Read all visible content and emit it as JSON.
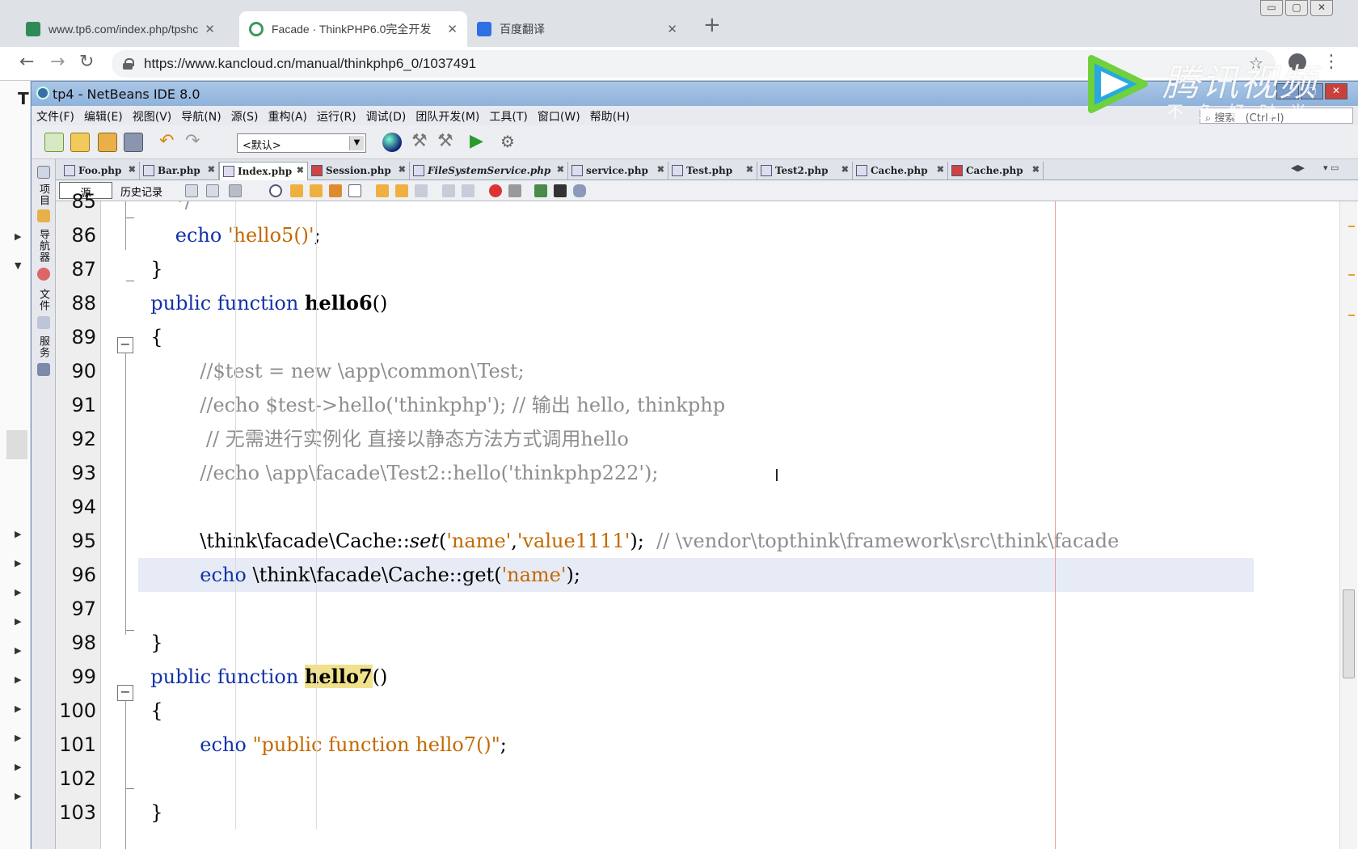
{
  "browser": {
    "tabs": [
      {
        "title": "www.tp6.com/index.php/tpshc",
        "close": "✕",
        "active": false,
        "favicon_color": "#2e8b57"
      },
      {
        "title": "Facade · ThinkPHP6.0完全开发",
        "close": "✕",
        "active": true,
        "favicon_color": "#3a9a5c"
      },
      {
        "title": "百度翻译",
        "close": "✕",
        "active": false,
        "favicon_color": "#2f6fe4"
      }
    ],
    "new_tab": "+",
    "url": "https://www.kancloud.cn/manual/thinkphp6_0/1037491",
    "window_controls": [
      "▭",
      "▢",
      "✕"
    ],
    "page_left_letter": "T"
  },
  "watermark": {
    "brand": "腾讯视频",
    "slogan": "不负好时光"
  },
  "netbeans": {
    "title": "tp4 - NetBeans IDE 8.0",
    "window_controls": [
      "_",
      "▢",
      "✕"
    ],
    "menu": [
      "文件(F)",
      "编辑(E)",
      "视图(V)",
      "导航(N)",
      "源(S)",
      "重构(A)",
      "运行(R)",
      "调试(D)",
      "团队开发(M)",
      "工具(T)",
      "窗口(W)",
      "帮助(H)"
    ],
    "search_label": "搜索",
    "search_shortcut": "(Ctrl+I)",
    "config_select": "<默认>",
    "side_panels": [
      "项目",
      "导航器",
      "文件",
      "服务"
    ],
    "editor_tabs": [
      {
        "label": "Foo.php",
        "active": false
      },
      {
        "label": "Bar.php",
        "active": false
      },
      {
        "label": "Index.php",
        "active": true
      },
      {
        "label": "Session.php",
        "active": false
      },
      {
        "label": "FileSystemService.php",
        "active": false
      },
      {
        "label": "service.php",
        "active": false
      },
      {
        "label": "Test.php",
        "active": false
      },
      {
        "label": "Test2.php",
        "active": false
      },
      {
        "label": "Cache.php",
        "active": false
      },
      {
        "label": "Cache.php",
        "active": false
      }
    ],
    "editor_toolbar": {
      "source": "源",
      "history": "历史记录"
    },
    "code": [
      {
        "n": "85",
        "segs": [
          {
            "t": "      */",
            "c": "cmt"
          }
        ]
      },
      {
        "n": "86",
        "segs": [
          {
            "t": "      ",
            "c": ""
          },
          {
            "t": "echo",
            "c": "kw"
          },
          {
            "t": " ",
            "c": ""
          },
          {
            "t": "'hello5()'",
            "c": "str"
          },
          {
            "t": ";",
            "c": ""
          }
        ]
      },
      {
        "n": "87",
        "segs": [
          {
            "t": "  }",
            "c": ""
          }
        ]
      },
      {
        "n": "88",
        "segs": [
          {
            "t": "  ",
            "c": ""
          },
          {
            "t": "public function",
            "c": "kw"
          },
          {
            "t": " ",
            "c": ""
          },
          {
            "t": "hello6",
            "c": "fn"
          },
          {
            "t": "()",
            "c": ""
          }
        ]
      },
      {
        "n": "89",
        "segs": [
          {
            "t": "  {",
            "c": ""
          }
        ]
      },
      {
        "n": "90",
        "segs": [
          {
            "t": "          //$test = new \\app\\common\\Test;",
            "c": "cmt"
          }
        ]
      },
      {
        "n": "91",
        "segs": [
          {
            "t": "          //echo $test->hello('thinkphp'); // 输出 hello, thinkphp",
            "c": "cmt"
          }
        ]
      },
      {
        "n": "92",
        "segs": [
          {
            "t": "           // 无需进行实例化 直接以静态方法方式调用hello",
            "c": "cmt"
          }
        ]
      },
      {
        "n": "93",
        "segs": [
          {
            "t": "          //echo \\app\\facade\\Test2::hello('thinkphp222');",
            "c": "cmt"
          }
        ]
      },
      {
        "n": "94",
        "segs": [
          {
            "t": "",
            "c": ""
          }
        ]
      },
      {
        "n": "95",
        "segs": [
          {
            "t": "          \\think\\facade\\Cache::",
            "c": ""
          },
          {
            "t": "set",
            "c": "it"
          },
          {
            "t": "(",
            "c": ""
          },
          {
            "t": "'name'",
            "c": "str"
          },
          {
            "t": ",",
            "c": ""
          },
          {
            "t": "'value1111'",
            "c": "str"
          },
          {
            "t": ");  ",
            "c": ""
          },
          {
            "t": "// \\vendor\\topthink\\framework\\src\\think\\facade",
            "c": "cmt"
          }
        ]
      },
      {
        "n": "96",
        "segs": [
          {
            "t": "          ",
            "c": ""
          },
          {
            "t": "echo",
            "c": "kw"
          },
          {
            "t": " \\think\\facade\\Cache::get(",
            "c": ""
          },
          {
            "t": "'name'",
            "c": "str"
          },
          {
            "t": ");",
            "c": ""
          }
        ],
        "hl": true
      },
      {
        "n": "97",
        "segs": [
          {
            "t": "",
            "c": ""
          }
        ]
      },
      {
        "n": "98",
        "segs": [
          {
            "t": "  }",
            "c": ""
          }
        ]
      },
      {
        "n": "99",
        "segs": [
          {
            "t": "  ",
            "c": ""
          },
          {
            "t": "public function",
            "c": "kw"
          },
          {
            "t": " ",
            "c": ""
          },
          {
            "t": "hello7",
            "c": "fn mark"
          },
          {
            "t": "()",
            "c": ""
          }
        ]
      },
      {
        "n": "100",
        "segs": [
          {
            "t": "  {",
            "c": ""
          }
        ]
      },
      {
        "n": "101",
        "segs": [
          {
            "t": "          ",
            "c": ""
          },
          {
            "t": "echo",
            "c": "kw"
          },
          {
            "t": " ",
            "c": ""
          },
          {
            "t": "\"public function hello7()\"",
            "c": "str"
          },
          {
            "t": ";",
            "c": ""
          }
        ]
      },
      {
        "n": "102",
        "segs": [
          {
            "t": "",
            "c": ""
          }
        ]
      },
      {
        "n": "103",
        "segs": [
          {
            "t": "  }",
            "c": ""
          }
        ]
      }
    ]
  }
}
